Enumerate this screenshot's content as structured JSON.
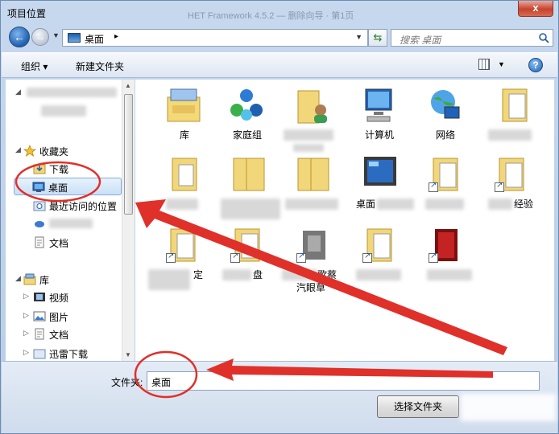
{
  "window": {
    "title": "项目位置",
    "close_label": "x",
    "background_tab_text": "HET Framework 4.5.2 — 删除向导 · 第1页"
  },
  "navbar": {
    "address_text": "桌面",
    "address_separator": "▸",
    "search_placeholder": "搜索 桌面"
  },
  "toolbar": {
    "organize_label": "组织 ▾",
    "new_folder_label": "新建文件夹",
    "help_label": "?"
  },
  "nav_pane": {
    "favorites_label": "收藏夹",
    "downloads_label": "下载",
    "desktop_label": "桌面",
    "recent_label": "最近访问的位置",
    "documents_fav_label": "文档",
    "library_label": "库",
    "video_label": "视频",
    "pictures_label": "图片",
    "documents_label": "文档",
    "xunlei_label": "迅雷下载"
  },
  "files": {
    "library": "库",
    "homegroup": "家庭组",
    "computer": "计算机",
    "network": "网络",
    "partial_desktop": "桌面",
    "partial_experiment": "经验",
    "partial_shortcut": "定",
    "partial_folder": "盘",
    "partial_app": "歌蔡",
    "partial_app_line2": "汽眼草"
  },
  "bottom": {
    "folder_label": "文件夹:",
    "folder_value": "桌面",
    "select_button": "选择文件夹"
  },
  "colors": {
    "annotation_red": "#e0302a",
    "selection_blue": "#c9e0f7",
    "chrome_blue": "#b9cde6"
  }
}
